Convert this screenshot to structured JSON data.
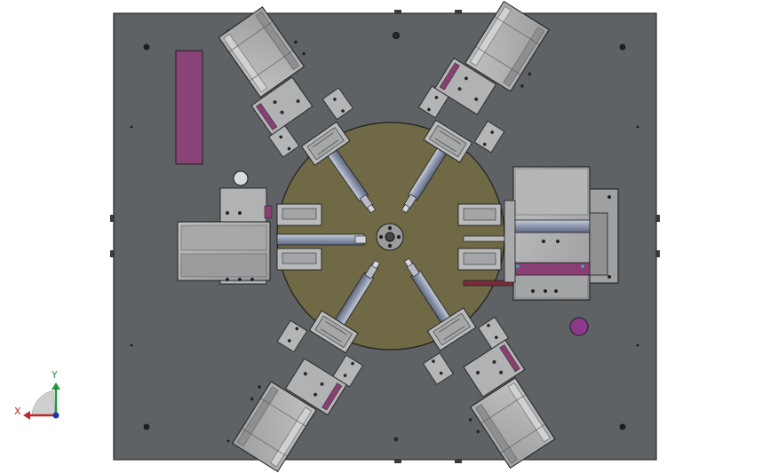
{
  "viewport": {
    "model": "rotary-indexing-fixture-assembly",
    "background": "#ffffff",
    "colors": {
      "base_plate": "#5f6264",
      "base_plate_edge": "#2a2a2a",
      "turntable": "#6f6a45",
      "module_face": "#a9aaab",
      "module_dark": "#7d7f82",
      "module_light": "#c4c5c6",
      "outline": "#1d1d1d",
      "rod": "#9aa3b6",
      "accent_magenta": "#8a3f72",
      "accent_dark_red": "#7a2a3a",
      "purple_knob": "#8b3a8c"
    }
  },
  "triad": {
    "x_label": "X",
    "y_label": "Y",
    "x_color": "#c0262b",
    "y_color": "#1f9a3a",
    "origin_color": "#1a36b8"
  }
}
